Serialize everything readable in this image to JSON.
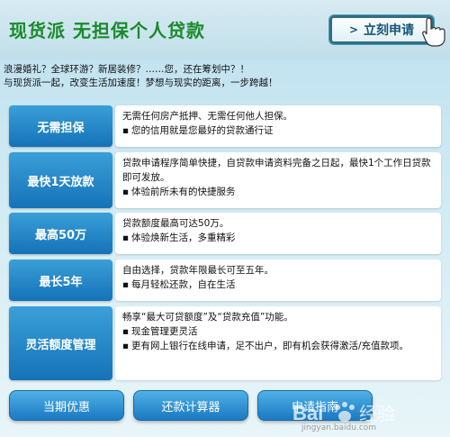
{
  "header": {
    "title": "现货派 无担保个人贷款",
    "apply_label": "立刻申请"
  },
  "intro": {
    "line1": "浪漫婚礼？全球环游？新居装修？……您，还在筹划中？！",
    "line2": "与现货派一起，改变生活加速度！梦想与现实的距离，一步跨越！"
  },
  "features": [
    {
      "label": "无需担保",
      "text": "无需任何房产抵押、无需任何他人担保。",
      "bullets": [
        "您的信用就是您最好的贷款通行证"
      ]
    },
    {
      "label": "最快1天放款",
      "text": "贷款申请程序简单快捷，自贷款申请资料完备之日起，最快1个工作日贷款即可发放。",
      "bullets": [
        "体验前所未有的快捷服务"
      ]
    },
    {
      "label": "最高50万",
      "text": "贷款额度最高可达50万。",
      "bullets": [
        "体验焕新生活，多重精彩"
      ]
    },
    {
      "label": "最长5年",
      "text": "自由选择，贷款年限最长可至五年。",
      "bullets": [
        "每月轻松还款，自在生活"
      ]
    },
    {
      "label": "灵活额度管理",
      "text": "畅享“最大可贷额度”及“贷款充值”功能。",
      "bullets": [
        "现金管理更灵活",
        "更有网上银行在线申请，足不出户，即有机会获得激活/充值款项。"
      ]
    }
  ],
  "bottom_buttons": [
    {
      "label": "当期优惠"
    },
    {
      "label": "还款计算器"
    },
    {
      "label": "申请指南"
    }
  ],
  "watermark": {
    "brand": "Bai 经验",
    "url": "jingyan.baidu.com"
  },
  "colors": {
    "title_green": "#1a8a2c",
    "label_blue": "#1572b8",
    "background": "#cfe8f0"
  }
}
